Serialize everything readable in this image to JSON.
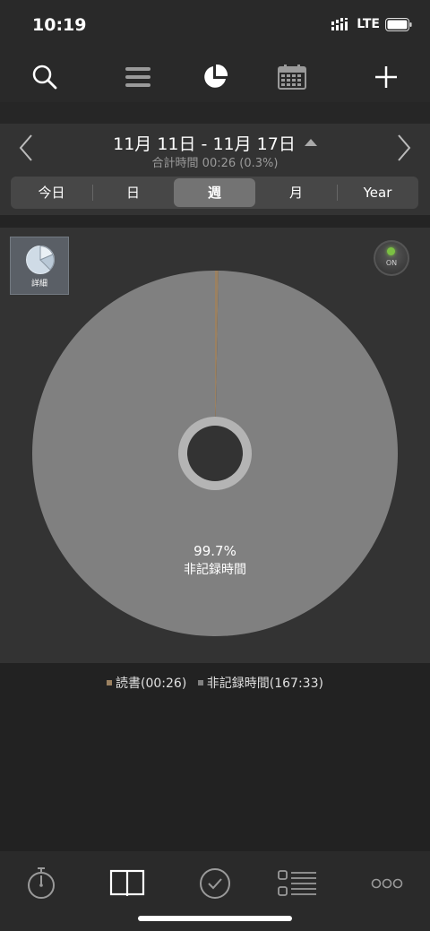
{
  "status": {
    "time": "10:19",
    "network": "LTE"
  },
  "toolbar": {
    "icons": [
      "search-icon",
      "list-icon",
      "pie-chart-icon",
      "calendar-icon",
      "plus-icon"
    ],
    "active": "pie-chart-icon"
  },
  "date_header": {
    "range": "11月 11日 - 11月 17日",
    "total": "合計時間 00:26 (0.3%)"
  },
  "period_tabs": [
    {
      "label": "今日",
      "active": false
    },
    {
      "label": "日",
      "active": false
    },
    {
      "label": "週",
      "active": true
    },
    {
      "label": "月",
      "active": false
    },
    {
      "label": "Year",
      "active": false
    }
  ],
  "detail_button": {
    "label": "詳細"
  },
  "toggle": {
    "label": "ON",
    "state": "on"
  },
  "chart_data": {
    "type": "pie",
    "categories": [
      "読書",
      "非記録時間"
    ],
    "values": [
      0.3,
      99.7
    ],
    "durations": [
      "00:26",
      "167:33"
    ],
    "colors": [
      "#9b8161",
      "#808080"
    ],
    "slice_label": {
      "percent": "99.7%",
      "name": "非記録時間"
    },
    "legend": [
      "読書(00:26)",
      "非記録時間(167:33)"
    ]
  },
  "bottom_nav": {
    "icons": [
      "stopwatch-icon",
      "book-icon",
      "check-circle-icon",
      "checklist-icon",
      "more-icon"
    ]
  }
}
